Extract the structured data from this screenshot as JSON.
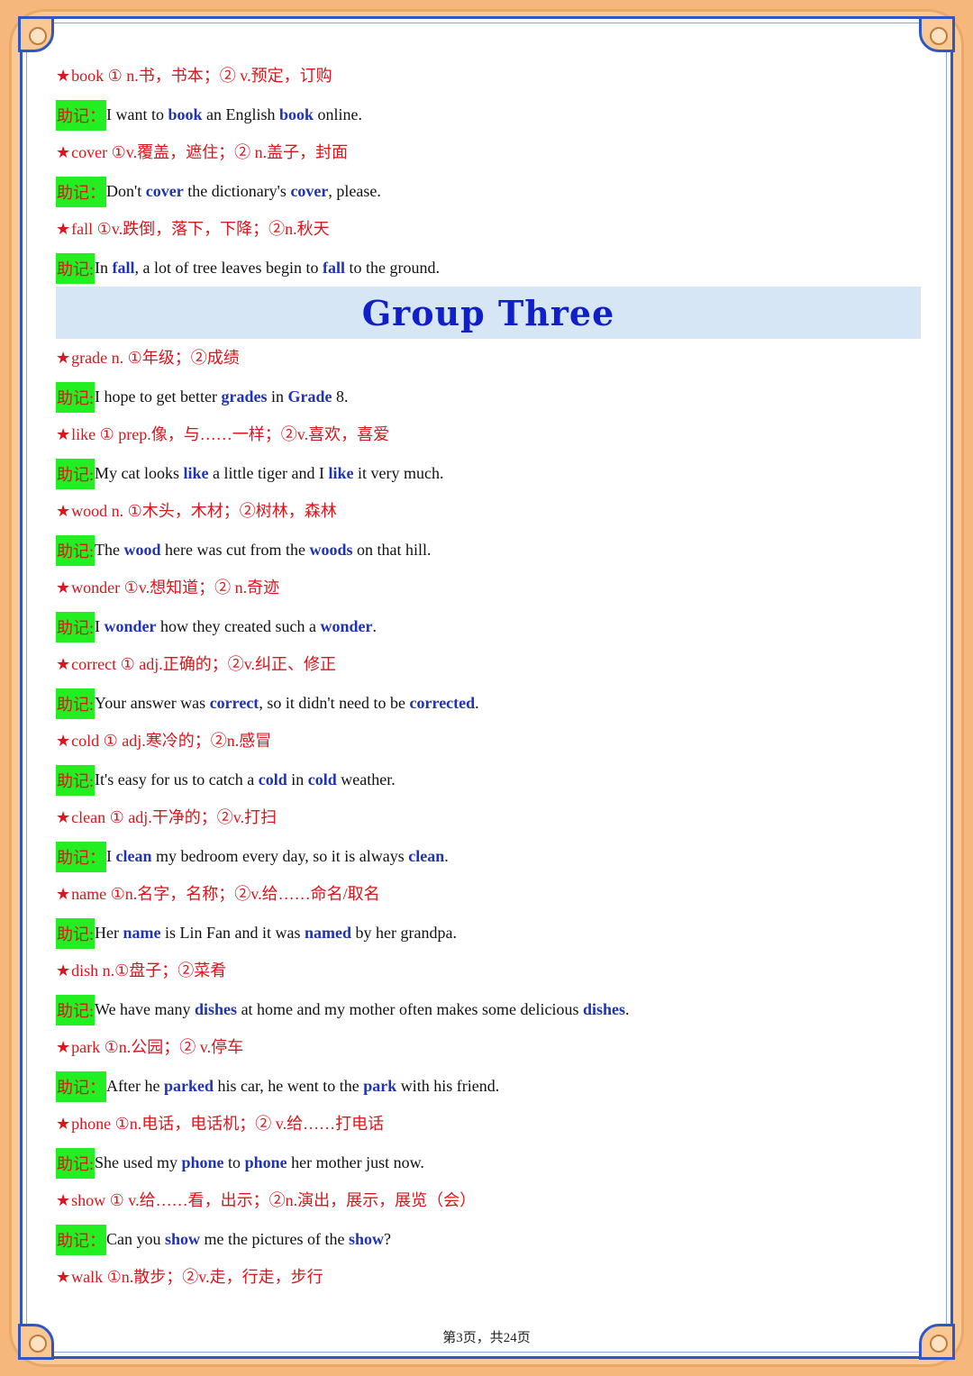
{
  "section_title": "Group Three",
  "memo_tag": "助记:",
  "memo_tag_full": "助记：",
  "entries_top": [
    {
      "def": "book ① n.书，书本；② v.预定，订购",
      "ex": [
        {
          "t": "I want to "
        },
        {
          "t": "book",
          "k": 1
        },
        {
          "t": " an English "
        },
        {
          "t": "book",
          "k": 1
        },
        {
          "t": " online."
        }
      ],
      "tagFull": true
    },
    {
      "def": "cover ①v.覆盖，遮住；② n.盖子，封面",
      "ex": [
        {
          "t": "Don't "
        },
        {
          "t": "cover",
          "k": 1
        },
        {
          "t": " the dictionary's "
        },
        {
          "t": "cover",
          "k": 1
        },
        {
          "t": ", please."
        }
      ],
      "tagFull": true
    },
    {
      "def": "fall ①v.跌倒，落下，下降；②n.秋天",
      "ex": [
        {
          "t": "In "
        },
        {
          "t": "fall",
          "k": 1
        },
        {
          "t": ", a lot of tree leaves begin to "
        },
        {
          "t": "fall",
          "k": 1
        },
        {
          "t": " to the ground."
        }
      ]
    }
  ],
  "entries": [
    {
      "def": "grade n. ①年级；②成绩",
      "ex": [
        {
          "t": "I hope to get better "
        },
        {
          "t": "grades",
          "k": 1
        },
        {
          "t": " in "
        },
        {
          "t": "Grade",
          "k": 1
        },
        {
          "t": " 8."
        }
      ]
    },
    {
      "def": "like ① prep.像，与……一样；②v.喜欢，喜爱",
      "ex": [
        {
          "t": "My cat looks "
        },
        {
          "t": "like",
          "k": 1
        },
        {
          "t": " a little tiger and I "
        },
        {
          "t": "like",
          "k": 1
        },
        {
          "t": " it very much."
        }
      ]
    },
    {
      "def": "wood n. ①木头，木材；②树林，森林",
      "ex": [
        {
          "t": "The "
        },
        {
          "t": "wood",
          "k": 1
        },
        {
          "t": " here was cut from the "
        },
        {
          "t": "woods",
          "k": 1
        },
        {
          "t": " on that hill."
        }
      ]
    },
    {
      "def": "wonder ①v.想知道；② n.奇迹",
      "ex": [
        {
          "t": "I "
        },
        {
          "t": "wonder",
          "k": 1
        },
        {
          "t": " how they created such a "
        },
        {
          "t": "wonder",
          "k": 1
        },
        {
          "t": "."
        }
      ]
    },
    {
      "def": "correct ① adj.正确的；②v.纠正、修正",
      "ex": [
        {
          "t": "Your answer was "
        },
        {
          "t": "correct",
          "k": 1
        },
        {
          "t": ", so it didn't need to be "
        },
        {
          "t": "corrected",
          "k": 1
        },
        {
          "t": "."
        }
      ]
    },
    {
      "def": "cold ① adj.寒冷的；②n.感冒",
      "ex": [
        {
          "t": "It's easy for us to catch a "
        },
        {
          "t": "cold",
          "k": 1
        },
        {
          "t": " in "
        },
        {
          "t": "cold",
          "k": 1
        },
        {
          "t": " weather."
        }
      ]
    },
    {
      "def": "clean ① adj.干净的；②v.打扫",
      "ex": [
        {
          "t": "I "
        },
        {
          "t": "clean",
          "k": 1
        },
        {
          "t": " my bedroom every day, so it is always "
        },
        {
          "t": "clean",
          "k": 1
        },
        {
          "t": "."
        }
      ],
      "tagFull": true
    },
    {
      "def": "name ①n.名字，名称；②v.给……命名/取名",
      "ex": [
        {
          "t": "Her "
        },
        {
          "t": "name",
          "k": 1
        },
        {
          "t": " is Lin Fan and it was "
        },
        {
          "t": "named",
          "k": 1
        },
        {
          "t": " by her grandpa."
        }
      ]
    },
    {
      "def": "dish n.①盘子；②菜肴",
      "ex": [
        {
          "t": "We have many "
        },
        {
          "t": "dishes",
          "k": 1
        },
        {
          "t": " at home and my mother often makes some delicious "
        },
        {
          "t": "dishes",
          "k": 1
        },
        {
          "t": "."
        }
      ]
    },
    {
      "def": "park ①n.公园；② v.停车",
      "ex": [
        {
          "t": "After he "
        },
        {
          "t": "parked",
          "k": 1
        },
        {
          "t": " his car, he went to the "
        },
        {
          "t": "park",
          "k": 1
        },
        {
          "t": " with his friend."
        }
      ],
      "tagFull": true
    },
    {
      "def": "phone ①n.电话，电话机；② v.给……打电话",
      "ex": [
        {
          "t": "She used my "
        },
        {
          "t": "phone",
          "k": 1
        },
        {
          "t": " to "
        },
        {
          "t": "phone",
          "k": 1
        },
        {
          "t": " her mother just now."
        }
      ]
    },
    {
      "def": "show ① v.给……看，出示；②n.演出，展示，展览（会）",
      "ex": [
        {
          "t": "Can you "
        },
        {
          "t": "show",
          "k": 1
        },
        {
          "t": " me the pictures of the "
        },
        {
          "t": "show",
          "k": 1
        },
        {
          "t": "?"
        }
      ],
      "tagFull": true
    },
    {
      "def": "walk ①n.散步；②v.走，行走，步行",
      "ex": null
    }
  ],
  "footer": "第3页，共24页"
}
